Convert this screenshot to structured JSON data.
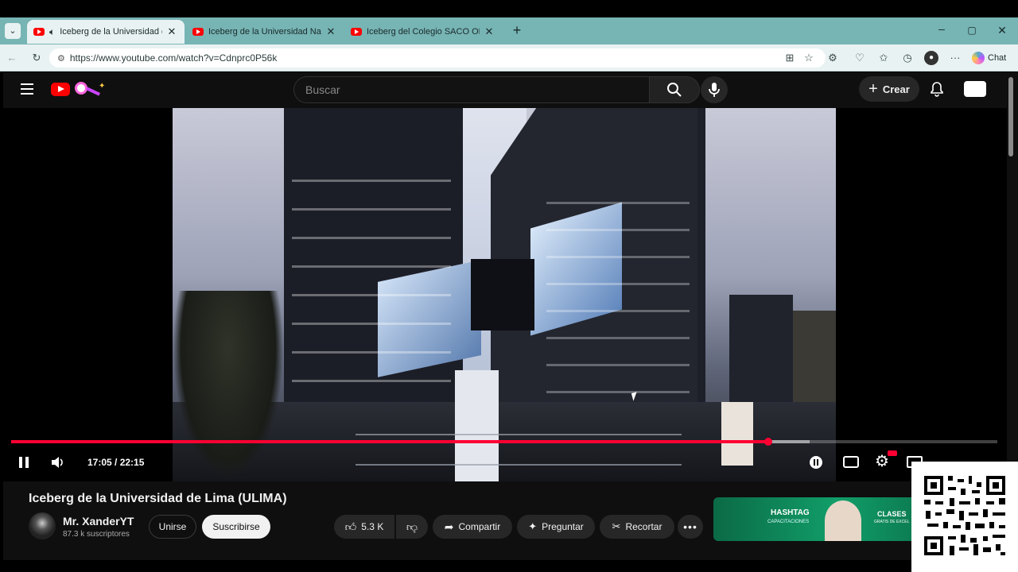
{
  "browser": {
    "tabs": [
      {
        "title": "Iceberg de la Universidad de L",
        "audio": true
      },
      {
        "title": "Iceberg de la Universidad Naciona"
      },
      {
        "title": "Iceberg del Colegio SACO OLIVEROS"
      }
    ],
    "url": "https://www.youtube.com/watch?v=Cdnprc0P56k",
    "chat_label": "Chat"
  },
  "youtube": {
    "search_placeholder": "Buscar",
    "create_label": "Crear",
    "player": {
      "time_current": "17:05",
      "time_total": "22:15",
      "time_display": "17:05 / 22:15",
      "progress_fraction": 0.768,
      "buffered_fraction": 0.81
    },
    "video": {
      "title": "Iceberg de la Universidad de Lima (ULIMA)",
      "channel": "Mr. XanderYT",
      "subscribers": "87.3 k suscriptores",
      "join_label": "Unirse",
      "subscribe_label": "Suscribirse",
      "likes": "5.3 K",
      "share_label": "Compartir",
      "ask_label": "Preguntar",
      "clip_label": "Recortar"
    },
    "ad": {
      "brand": "HASHTAG",
      "brand_sub": "CAPACITACIONES",
      "headline": "CLASES",
      "sub": "GRATIS DE EXCEL"
    }
  },
  "colors": {
    "accent": "#ff0033",
    "tabstrip": "#77b4b4",
    "yt_bg": "#0f0f0f"
  }
}
